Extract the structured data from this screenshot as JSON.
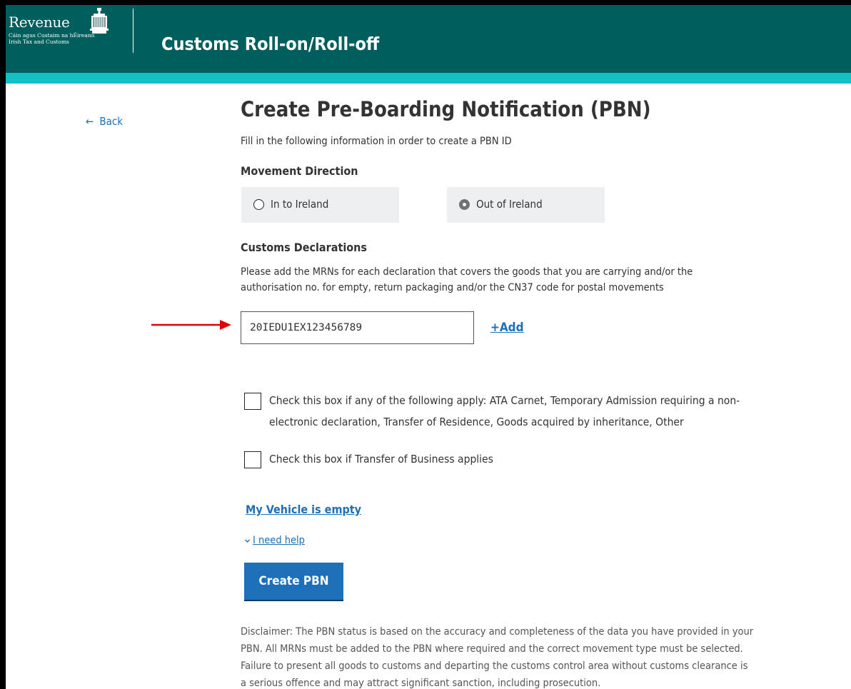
{
  "header": {
    "logo_word": "Revenue",
    "logo_sub_1": "Cáin agus Custaim na hÉireann",
    "logo_sub_2": "Irish Tax and Customs",
    "app_title": "Customs Roll-on/Roll-off"
  },
  "nav": {
    "back_label": "Back"
  },
  "form": {
    "title": "Create Pre-Boarding Notification (PBN)",
    "intro": "Fill in the following information in order to create a PBN ID",
    "movement_direction": {
      "label": "Movement Direction",
      "options": [
        {
          "label": "In to Ireland",
          "selected": false
        },
        {
          "label": "Out of Ireland",
          "selected": true
        }
      ]
    },
    "customs_declarations": {
      "label": "Customs Declarations",
      "description_line1": "Please add the MRNs for each declaration that covers the goods that you are carrying and/or the",
      "description_line2": "authorisation no. for empty, return packaging and/or the CN37 code for postal movements",
      "mrn_value": "20IEDU1EX123456789",
      "add_label": "+Add"
    },
    "checkboxes": [
      {
        "line1": "Check this box if any of the following apply: ATA Carnet, Temporary Admission requiring a non-",
        "line2": "electronic declaration, Transfer of Residence, Goods acquired by inheritance, Other",
        "checked": false
      },
      {
        "line1": "Check this box if Transfer of Business applies",
        "checked": false
      }
    ],
    "vehicle_empty_label": "My Vehicle is empty",
    "help_label": "I need help",
    "submit_label": "Create PBN"
  },
  "disclaimer": {
    "line1": "Disclaimer: The PBN status is based on the accuracy and completeness of the data you have provided in your",
    "line2": "PBN. All MRNs must be added to the PBN where required and the correct movement type must be selected.",
    "line3": "Failure to present all goods to customs and departing the customs control area without customs clearance is",
    "line4": "a serious offence and may attract significant sanction, including prosecution."
  },
  "colors": {
    "header_bg": "#005e5d",
    "header_stripe": "#12c2c2",
    "link": "#1d70b8",
    "button_bg": "#1d70b8",
    "annotation_arrow": "#e00000"
  },
  "icons": {
    "back": "arrow-left-icon",
    "logo": "harp-crest-icon",
    "help": "chevron-down-icon",
    "annotation": "red-arrow-icon"
  }
}
